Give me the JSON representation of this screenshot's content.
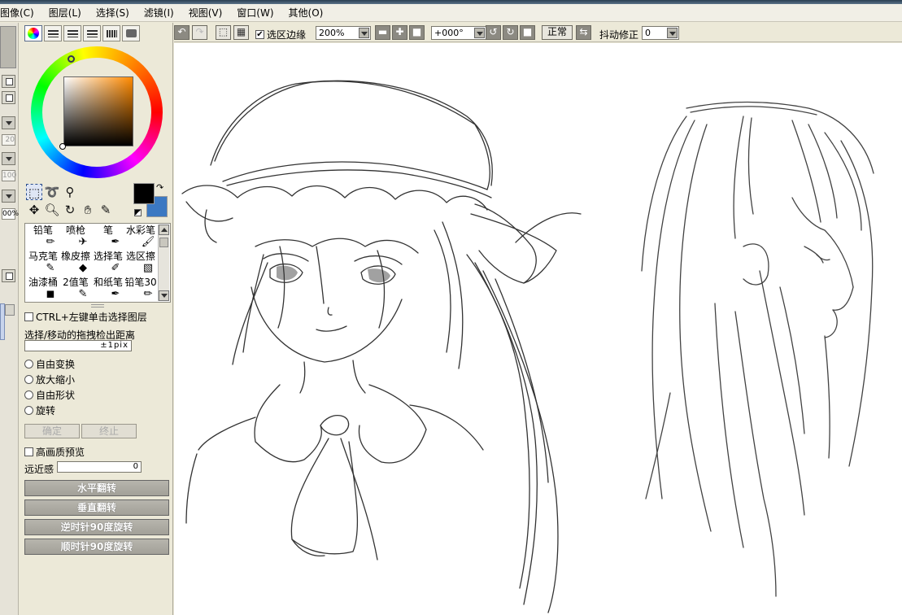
{
  "menu": {
    "items": [
      "图像(C)",
      "图层(L)",
      "选择(S)",
      "滤镜(I)",
      "视图(V)",
      "窗口(W)",
      "其他(O)"
    ]
  },
  "left_strip": {
    "values": [
      "20",
      "100",
      "00%"
    ]
  },
  "brushes": [
    {
      "name": "铅笔",
      "icon": "pencil-icon"
    },
    {
      "name": "喷枪",
      "icon": "airbrush-icon"
    },
    {
      "name": "笔",
      "icon": "pen-icon"
    },
    {
      "name": "水彩笔",
      "icon": "watercolor-icon"
    },
    {
      "name": "马克笔",
      "icon": "marker-icon"
    },
    {
      "name": "橡皮擦",
      "icon": "eraser-icon"
    },
    {
      "name": "选择笔",
      "icon": "selection-pen-icon"
    },
    {
      "name": "选区擦",
      "icon": "selection-eraser-icon"
    },
    {
      "name": "油漆桶",
      "icon": "bucket-icon"
    },
    {
      "name": "2值笔",
      "icon": "binary-pen-icon"
    },
    {
      "name": "和纸笔",
      "icon": "washi-pen-icon"
    },
    {
      "name": "铅笔30",
      "icon": "pencil-icon"
    }
  ],
  "move_tool": {
    "ctrl_click_label": "CTRL+左键单击选择图层",
    "drag_distance_label": "选择/移动的拖拽检出距离",
    "drag_distance_value": "±1pix"
  },
  "transform": {
    "options": [
      "自由变换",
      "放大缩小",
      "自由形状",
      "旋转"
    ],
    "ok_label": "确定",
    "cancel_label": "终止",
    "hq_preview_label": "高画质预览",
    "perspective_label": "远近感",
    "perspective_value": "0"
  },
  "actions": [
    "水平翻转",
    "垂直翻转",
    "逆时针90度旋转",
    "顺时针90度旋转"
  ],
  "toolbar": {
    "selection_edge_label": "选区边缘",
    "selection_edge_checked": true,
    "zoom_value": "200%",
    "angle_value": "+000°",
    "normal_label": "正常",
    "stabilizer_label": "抖动修正",
    "stabilizer_value": "0"
  },
  "colors": {
    "foreground": "#000000",
    "background": "#3b78c2"
  }
}
